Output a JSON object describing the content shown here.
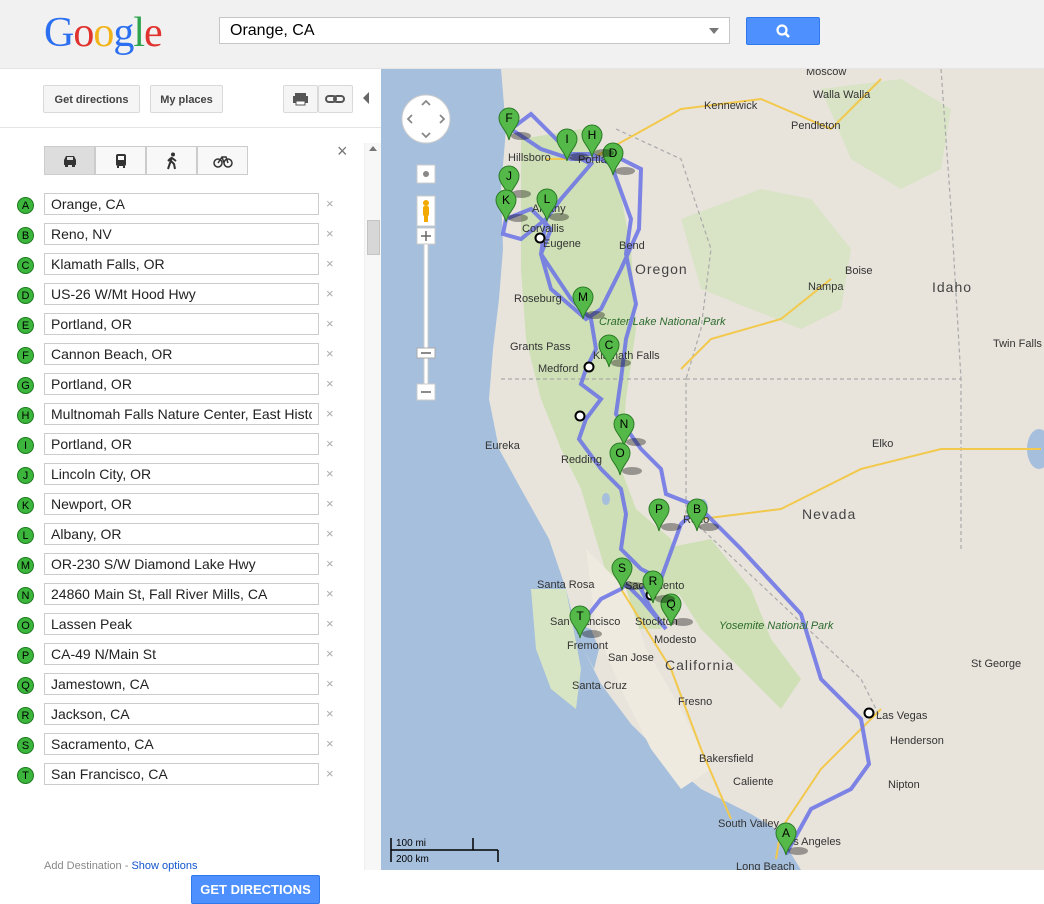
{
  "header": {
    "logo_text": "Google",
    "search_value": "Orange, CA",
    "search_button_icon": "search-icon"
  },
  "panel": {
    "get_directions_tab": "Get directions",
    "my_places_tab": "My places",
    "print_icon": "print-icon",
    "link_icon": "link-icon",
    "travel_modes": [
      "car-icon",
      "transit-icon",
      "walk-icon",
      "bike-icon"
    ],
    "active_mode": "car-icon",
    "waypoints": [
      {
        "marker": "A",
        "value": "Orange, CA"
      },
      {
        "marker": "B",
        "value": "Reno, NV"
      },
      {
        "marker": "C",
        "value": "Klamath Falls, OR"
      },
      {
        "marker": "D",
        "value": "US-26 W/Mt Hood Hwy"
      },
      {
        "marker": "E",
        "value": "Portland, OR"
      },
      {
        "marker": "F",
        "value": "Cannon Beach, OR"
      },
      {
        "marker": "G",
        "value": "Portland, OR"
      },
      {
        "marker": "H",
        "value": "Multnomah Falls Nature Center, East Historic"
      },
      {
        "marker": "I",
        "value": "Portland, OR"
      },
      {
        "marker": "J",
        "value": "Lincoln City, OR"
      },
      {
        "marker": "K",
        "value": "Newport, OR"
      },
      {
        "marker": "L",
        "value": "Albany, OR"
      },
      {
        "marker": "M",
        "value": "OR-230 S/W Diamond Lake Hwy"
      },
      {
        "marker": "N",
        "value": "24860 Main St, Fall River Mills, CA"
      },
      {
        "marker": "O",
        "value": "Lassen Peak"
      },
      {
        "marker": "P",
        "value": "CA-49 N/Main St"
      },
      {
        "marker": "Q",
        "value": "Jamestown, CA"
      },
      {
        "marker": "R",
        "value": "Jackson, CA"
      },
      {
        "marker": "S",
        "value": "Sacramento, CA"
      },
      {
        "marker": "T",
        "value": "San Francisco, CA"
      }
    ],
    "remove_glyph": "×",
    "add_destination": "Add Destination",
    "separator": " - ",
    "show_options": "Show options",
    "get_directions_button": "GET DIRECTIONS",
    "close_glyph": "×"
  },
  "map": {
    "states": [
      "Oregon",
      "Idaho",
      "Nevada",
      "California"
    ],
    "cities": [
      "Moscow",
      "Kennewick",
      "Walla Walla",
      "Pendleton",
      "Hillsboro",
      "Portland",
      "Corvallis",
      "Albany",
      "Eugene",
      "Bend",
      "Boise",
      "Nampa",
      "Roseburg",
      "Grants Pass",
      "Medford",
      "Klamath Falls",
      "Eureka",
      "Redding",
      "Elko",
      "Reno",
      "Santa Rosa",
      "Sacramento",
      "San Francisco",
      "Fremont",
      "San Jose",
      "Stockton",
      "Modesto",
      "Santa Cruz",
      "Fresno",
      "Las Vegas",
      "Henderson",
      "Nipton",
      "Bakersfield",
      "Caliente",
      "St George",
      "Twin Falls",
      "South Valley",
      "Los Angeles",
      "Long Beach"
    ],
    "parks": [
      "Crater Lake National Park",
      "Yosemite National Park"
    ],
    "pins": [
      "A",
      "B",
      "C",
      "D",
      "F",
      "H",
      "I",
      "J",
      "K",
      "L",
      "M",
      "N",
      "O",
      "P",
      "Q",
      "R",
      "S",
      "T"
    ],
    "scale_mi": "100 mi",
    "scale_km": "200 km",
    "route_color": "#6a72e6",
    "pin_color": "#54b948"
  }
}
